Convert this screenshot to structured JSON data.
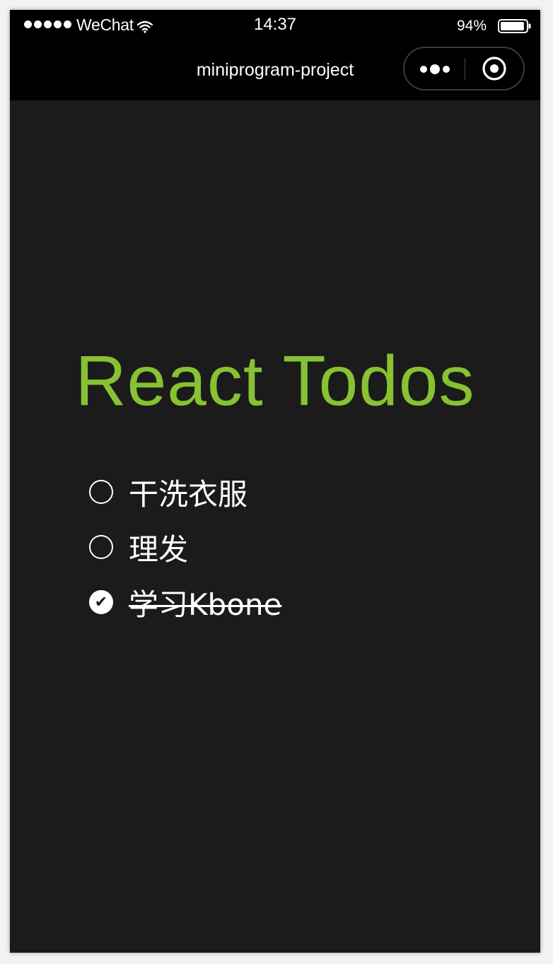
{
  "status_bar": {
    "carrier": "WeChat",
    "time": "14:37",
    "battery": "94%",
    "battery_level": 0.94,
    "signal_dots": 5
  },
  "nav_bar": {
    "title": "miniprogram-project",
    "more_icon": "more-dots-icon",
    "close_icon": "target-close-icon"
  },
  "app": {
    "title": "React Todos",
    "title_color": "#86c232",
    "background": "#1b1b1b",
    "todos": [
      {
        "label": "干洗衣服",
        "completed": false
      },
      {
        "label": "理发",
        "completed": false
      },
      {
        "label": "学习Kbone",
        "completed": true
      }
    ]
  }
}
